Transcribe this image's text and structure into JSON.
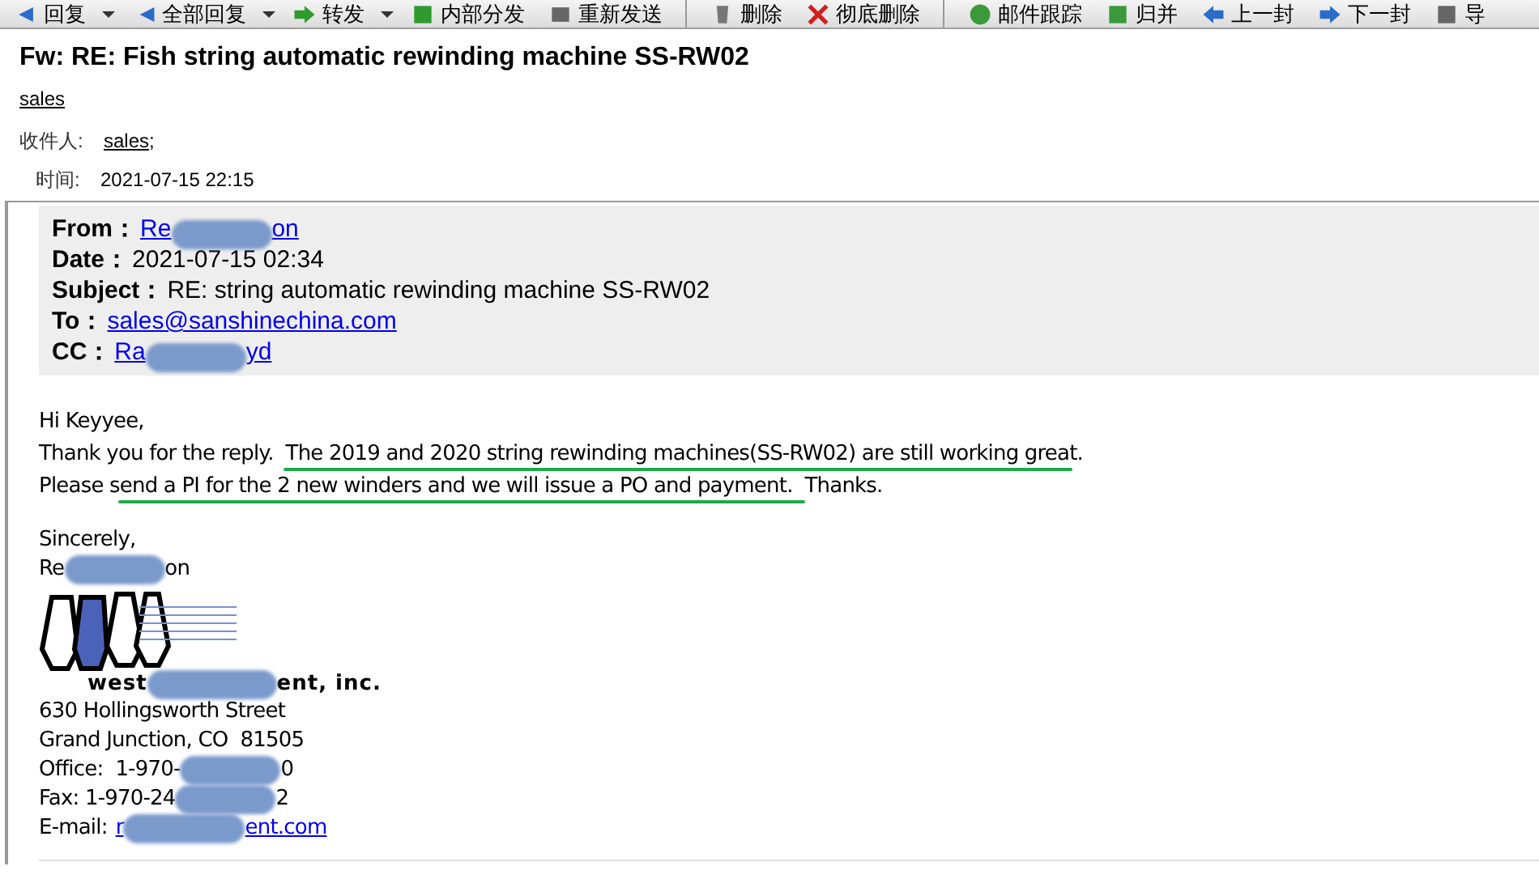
{
  "toolbar": [
    {
      "label": "回复",
      "dropdown": true
    },
    {
      "label": "全部回复",
      "dropdown": true
    },
    {
      "label": "转发",
      "dropdown": true
    },
    {
      "label": "内部分发",
      "dropdown": false
    },
    {
      "label": "重新发送",
      "dropdown": false
    },
    {
      "label": "删除",
      "dropdown": false
    },
    {
      "label": "彻底删除",
      "dropdown": false
    },
    {
      "label": "邮件跟踪",
      "dropdown": false
    },
    {
      "label": "归并",
      "dropdown": false
    },
    {
      "label": "上一封",
      "dropdown": false
    },
    {
      "label": "下一封",
      "dropdown": false
    },
    {
      "label": "导",
      "dropdown": false
    }
  ],
  "message": {
    "subject": "Fw: RE: Fish string automatic rewinding machine SS-RW02",
    "sender": "sales",
    "recipients_label": "收件人:",
    "recipient": "sales",
    "recipient_sep": ";",
    "time_label": "时间:",
    "time": "2021-07-15 22:15"
  },
  "quoted_header": [
    {
      "label": "From：",
      "value_start": "Re",
      "value_end": "on",
      "link": true,
      "redacted": true
    },
    {
      "label": "Date：",
      "value_start": "2021-07-15 02:34",
      "link": false,
      "redacted": false
    },
    {
      "label": "Subject：",
      "value_start": "RE: string automatic rewinding machine SS-RW02",
      "link": false,
      "redacted": false
    },
    {
      "label": "To：",
      "value_start": "sales@sanshinechina.com",
      "link": true,
      "redacted": false
    },
    {
      "label": "CC：",
      "value_start": "Ra",
      "value_end": "yd",
      "link": true,
      "redacted": true
    }
  ],
  "body": [
    "Hi Keyyee,",
    "Thank you for the reply.  The 2019 and 2020 string rewinding machines(SS-RW02) are still working great.",
    "Please send a PI for the 2 new winders and we will issue a PO and payment.  Thanks."
  ],
  "signature": {
    "closing": "Sincerely,",
    "name_start": "Re",
    "name_end": "on",
    "company_start": "west",
    "company_end": "ent, inc.",
    "lines": [
      {
        "start": "630 Hollingsworth Street",
        "redacted": false
      },
      {
        "start": "Grand Junction, CO  81505",
        "redacted": false
      },
      {
        "start": "Office:  1-970-",
        "end": "0",
        "redacted": true
      },
      {
        "start": "Fax: 1-970-24",
        "end": "2",
        "redacted": true
      }
    ],
    "email_label": "E-mail:",
    "email_start": "r",
    "email_end": "ent.com"
  }
}
